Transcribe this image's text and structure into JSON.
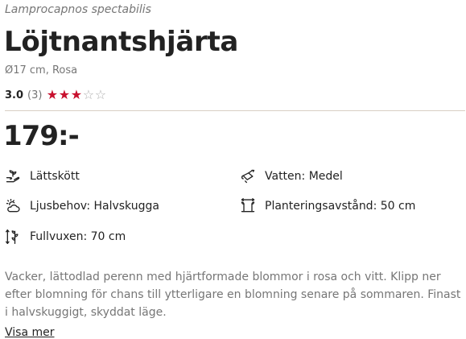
{
  "product": {
    "latin_name": "Lamprocapnos spectabilis",
    "name": "Löjtnantshjärta",
    "variant": "Ø17 cm, Rosa",
    "rating": {
      "score": "3.0",
      "count": "(3)",
      "stars_filled": 3,
      "stars_total": 5,
      "star_color": "#c8102e"
    },
    "price": "179:-"
  },
  "attributes": {
    "care": {
      "label": "Lättskött",
      "icon": "plant-hand-icon"
    },
    "water": {
      "label": "Vatten: Medel",
      "icon": "watering-can-icon"
    },
    "light": {
      "label": "Ljusbehov: Halvskugga",
      "icon": "partly-cloudy-icon"
    },
    "spacing": {
      "label": "Planteringsavstånd: 50 cm",
      "icon": "plant-spacing-icon"
    },
    "height": {
      "label": "Fullvuxen: 70 cm",
      "icon": "plant-height-icon"
    }
  },
  "description": {
    "text": "Vacker, lättodlad perenn med hjärtformade blommor i rosa och vitt. Klipp ner efter blomning för chans till ytterligare en blomning senare på sommaren. Finast i halvskuggigt, skyddat läge.",
    "read_more": "Visa mer"
  }
}
